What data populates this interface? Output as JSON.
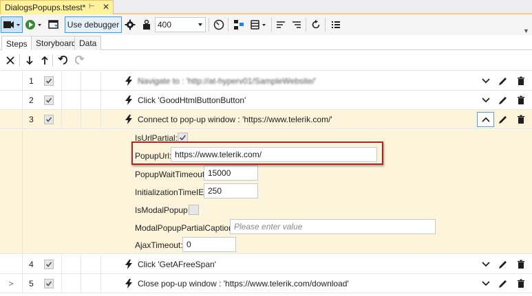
{
  "document_tab": {
    "title": "DialogsPopups.tstest*"
  },
  "toolbar": {
    "use_debugger_label": "Use debugger",
    "delay_value": "400"
  },
  "subtabs": [
    "Steps",
    "Storyboard",
    "Data"
  ],
  "steps": [
    {
      "num": "1",
      "desc": "Navigate to : 'http://at-hyperv01/SampleWebsite/'",
      "desc_blurred": true,
      "chevron": "down"
    },
    {
      "num": "2",
      "desc": "Click 'GoodHtmlButtonButton'",
      "chevron": "down"
    },
    {
      "num": "3",
      "desc": "Connect to pop-up window : 'https://www.telerik.com/'",
      "chevron": "up",
      "selected": true
    },
    {
      "num": "4",
      "desc": "Click 'GetAFreeSpan'",
      "chevron": "down"
    },
    {
      "num": "5",
      "desc": "Close pop-up window : 'https://www.telerik.com/download'",
      "chevron": "down",
      "expander": ">"
    }
  ],
  "properties": {
    "is_url_partial": {
      "label": "IsUrlPartial:",
      "checked": true
    },
    "popup_url": {
      "label": "PopupUrl:",
      "value": "https://www.telerik.com/"
    },
    "popup_wait_timeout": {
      "label": "PopupWaitTimeout:",
      "value": "15000"
    },
    "initialization_time_ie": {
      "label": "InitializationTimeIE:",
      "value": "250"
    },
    "is_modal_popup": {
      "label": "IsModalPopup:",
      "checked": false
    },
    "modal_popup_partial_caption": {
      "label": "ModalPopupPartialCaption:",
      "placeholder": "Please enter value",
      "value": ""
    },
    "ajax_timeout": {
      "label": "AjaxTimeout:",
      "value": "0"
    }
  },
  "colors": {
    "selected_row_bg": "#fdf4dc",
    "tab_highlight": "#fff29d",
    "highlight_border": "#b22222",
    "selection_blue": "#3399ff"
  }
}
